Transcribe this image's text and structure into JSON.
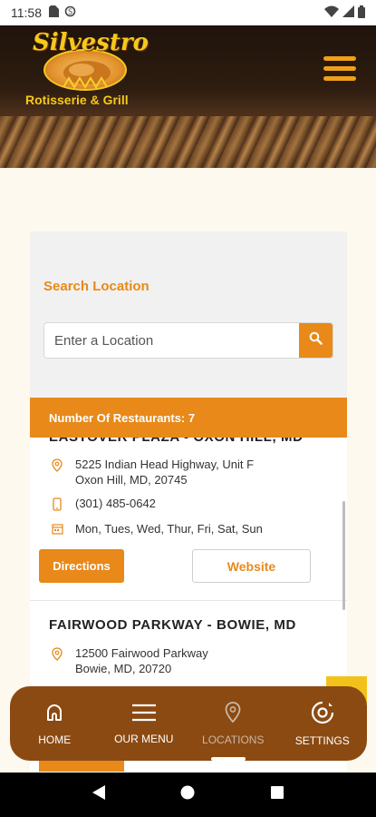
{
  "status_bar": {
    "time": "11:58"
  },
  "header": {
    "logo_script": "Silvestro",
    "logo_subtitle": "Rotisserie & Grill"
  },
  "search": {
    "label": "Search Location",
    "placeholder": "Enter a Location",
    "value": ""
  },
  "results": {
    "count_text": "Number Of Restaurants: 7",
    "locations": [
      {
        "name": "EASTOVER PLAZA - OXON HILL, MD",
        "address_line1": "5225 Indian Head Highway, Unit F",
        "address_line2": "Oxon Hill, MD, 20745",
        "phone": "(301) 485-0642",
        "days": "Mon, Tues, Wed, Thur, Fri, Sat, Sun",
        "directions_label": "Directions",
        "website_label": "Website"
      },
      {
        "name": "FAIRWOOD PARKWAY - BOWIE, MD",
        "address_line1": "12500 Fairwood Parkway",
        "address_line2": "Bowie, MD, 20720"
      }
    ]
  },
  "bottom_nav": {
    "items": [
      {
        "label": "HOME",
        "icon": "home-icon"
      },
      {
        "label": "OUR MENU",
        "icon": "menu-lines-icon"
      },
      {
        "label": "LOCATIONS",
        "icon": "location-pin-icon"
      },
      {
        "label": "SETTINGS",
        "icon": "settings-icon"
      }
    ],
    "active": "LOCATIONS"
  },
  "colors": {
    "accent": "#e8891a",
    "nav_bg": "#8b4a12",
    "page_bg": "#fdf9ef"
  }
}
